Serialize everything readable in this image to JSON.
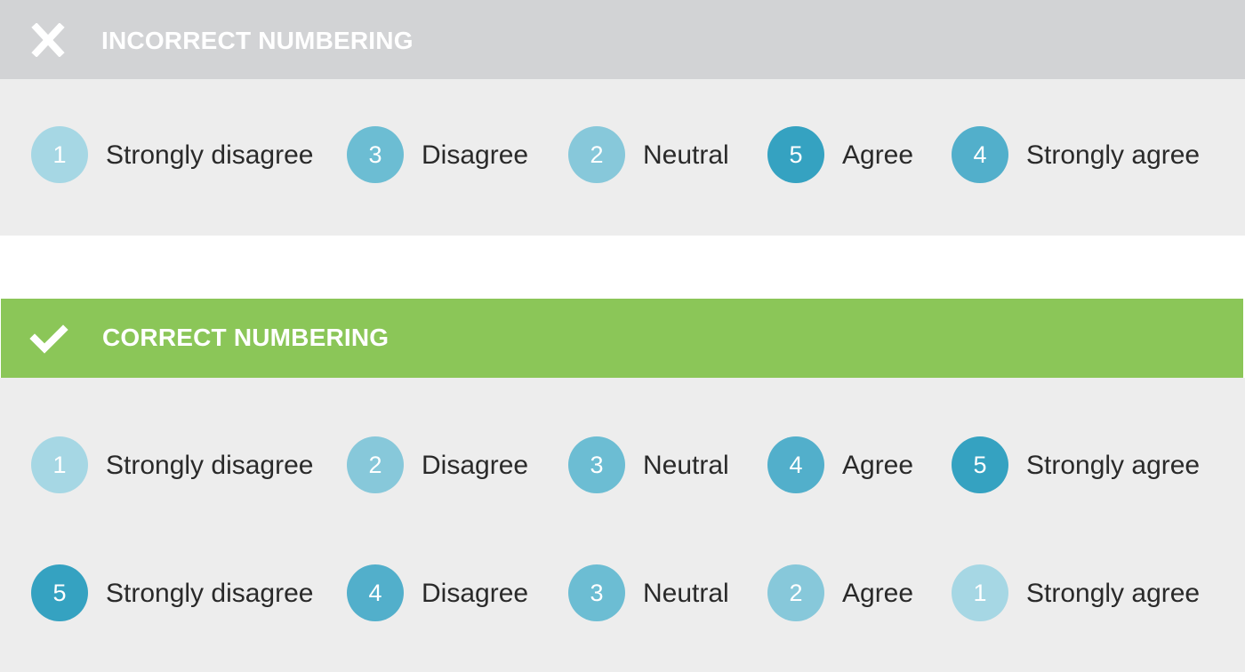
{
  "colors": {
    "incorrect_header_bg": "#d2d3d5",
    "correct_header_bg": "#8bc658",
    "panel_bg": "#ededed",
    "scale": [
      "#a6d7e4",
      "#87c8da",
      "#6cbdd3",
      "#52afcb",
      "#35a2c1"
    ]
  },
  "incorrect": {
    "icon": "cross-icon",
    "title": "INCORRECT NUMBERING",
    "rows": [
      [
        {
          "number": "1",
          "label": "Strongly disagree",
          "level": 1
        },
        {
          "number": "3",
          "label": "Disagree",
          "level": 3
        },
        {
          "number": "2",
          "label": "Neutral",
          "level": 2
        },
        {
          "number": "5",
          "label": "Agree",
          "level": 5
        },
        {
          "number": "4",
          "label": "Strongly agree",
          "level": 4
        }
      ]
    ]
  },
  "correct": {
    "icon": "checkmark-icon",
    "title": "CORRECT NUMBERING",
    "rows": [
      [
        {
          "number": "1",
          "label": "Strongly disagree",
          "level": 1
        },
        {
          "number": "2",
          "label": "Disagree",
          "level": 2
        },
        {
          "number": "3",
          "label": "Neutral",
          "level": 3
        },
        {
          "number": "4",
          "label": "Agree",
          "level": 4
        },
        {
          "number": "5",
          "label": "Strongly agree",
          "level": 5
        }
      ],
      [
        {
          "number": "5",
          "label": "Strongly disagree",
          "level": 5
        },
        {
          "number": "4",
          "label": "Disagree",
          "level": 4
        },
        {
          "number": "3",
          "label": "Neutral",
          "level": 3
        },
        {
          "number": "2",
          "label": "Agree",
          "level": 2
        },
        {
          "number": "1",
          "label": "Strongly agree",
          "level": 1
        }
      ]
    ]
  }
}
